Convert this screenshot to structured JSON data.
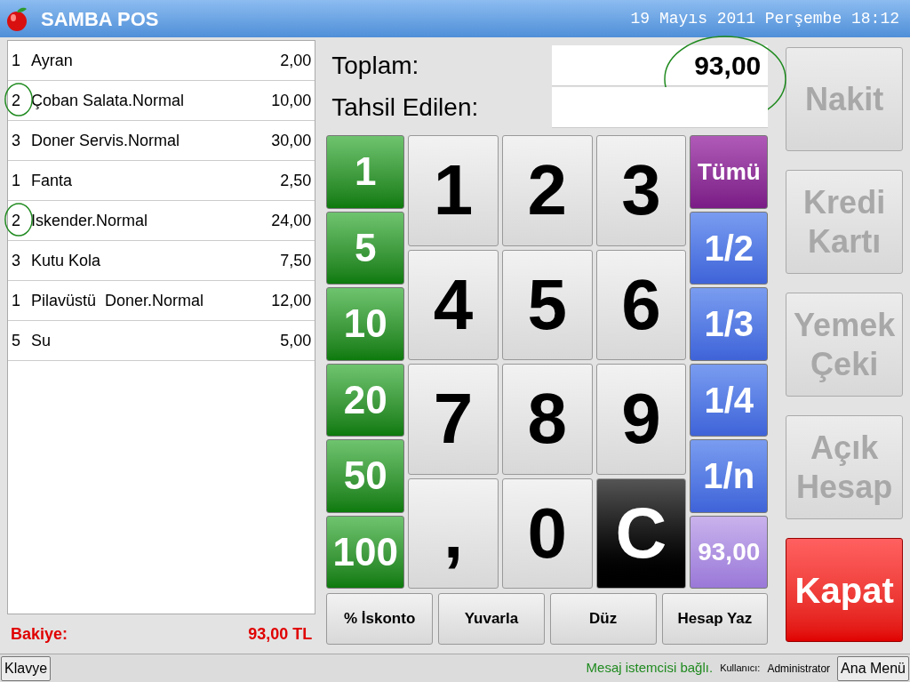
{
  "window": {
    "title": "SAMBA POS",
    "datetime": "19 Mayıs 2011 Perşembe 18:12"
  },
  "order_items": [
    {
      "quantity": "1",
      "name": "Ayran",
      "price": "2,00",
      "circled": false
    },
    {
      "quantity": "2",
      "name": "Çoban Salata.Normal",
      "price": "10,00",
      "circled": true
    },
    {
      "quantity": "3",
      "name": "Doner Servis.Normal",
      "price": "30,00",
      "circled": false
    },
    {
      "quantity": "1",
      "name": "Fanta",
      "price": "2,50",
      "circled": false
    },
    {
      "quantity": "2",
      "name": "Iskender.Normal",
      "price": "24,00",
      "circled": true
    },
    {
      "quantity": "3",
      "name": "Kutu Kola",
      "price": "7,50",
      "circled": false
    },
    {
      "quantity": "1",
      "name": "Pilavüstü  Doner.Normal",
      "price": "12,00",
      "circled": false
    },
    {
      "quantity": "5",
      "name": "Su",
      "price": "5,00",
      "circled": false
    }
  ],
  "balance": {
    "label": "Bakiye:",
    "value": "93,00 TL"
  },
  "totals": [
    {
      "label": "Toplam:",
      "value": "93,00",
      "circled": true
    },
    {
      "label": "Tahsil Edilen:",
      "circled": false
    }
  ],
  "amount_buttons": [
    "1",
    "5",
    "10",
    "20",
    "50",
    "100"
  ],
  "keypad": [
    {
      "label": "1",
      "kind": "digit"
    },
    {
      "label": "2",
      "kind": "digit"
    },
    {
      "label": "3",
      "kind": "digit"
    },
    {
      "label": "4",
      "kind": "digit"
    },
    {
      "label": "5",
      "kind": "digit"
    },
    {
      "label": "6",
      "kind": "digit"
    },
    {
      "label": "7",
      "kind": "digit"
    },
    {
      "label": "8",
      "kind": "digit"
    },
    {
      "label": "9",
      "kind": "digit"
    },
    {
      "label": ",",
      "kind": "digit"
    },
    {
      "label": "0",
      "kind": "digit"
    },
    {
      "label": "C",
      "kind": "clear"
    }
  ],
  "split_buttons": [
    {
      "label": "Tümü",
      "kind": "all"
    },
    {
      "label": "1/2",
      "kind": "fraction"
    },
    {
      "label": "1/3",
      "kind": "fraction"
    },
    {
      "label": "1/4",
      "kind": "fraction"
    },
    {
      "label": "1/n",
      "kind": "fraction"
    },
    {
      "label": "93,00",
      "kind": "amount"
    }
  ],
  "action_buttons": [
    "% İskonto",
    "Yuvarla",
    "Düz",
    "Hesap Yaz"
  ],
  "payment_buttons": [
    {
      "label": "Nakit",
      "disabled": true
    },
    {
      "label": "Kredi Kartı",
      "disabled": true
    },
    {
      "label": "Yemek Çeki",
      "disabled": true
    },
    {
      "label": "Açık Hesap",
      "disabled": true
    },
    {
      "label": "Kapat",
      "disabled": false
    }
  ],
  "status_bar": {
    "keyboard_button": "Klavye",
    "message": "Mesaj istemcisi bağlı.",
    "user_label": "Kullanıcı:",
    "user": "Administrator",
    "menu_button": "Ana Menü"
  }
}
